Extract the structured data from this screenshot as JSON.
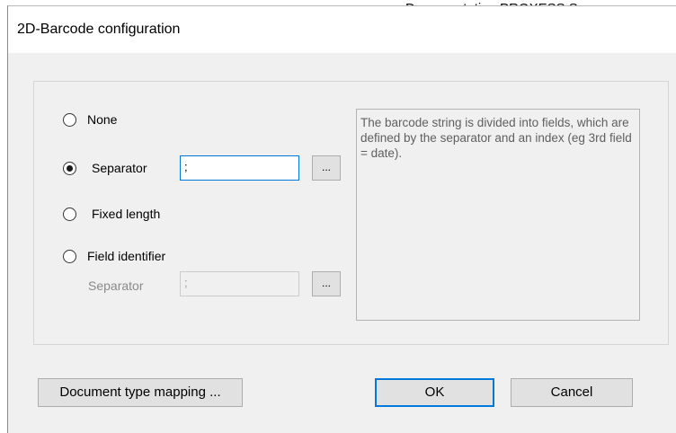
{
  "document_header": "Documentation PROXESS Scan",
  "dialog": {
    "title": "2D-Barcode configuration",
    "options": [
      {
        "label": "None",
        "selected": false
      },
      {
        "label": "Separator",
        "selected": true
      },
      {
        "label": "Fixed length",
        "selected": false
      },
      {
        "label": "Field identifier",
        "selected": false
      }
    ],
    "separator_value": ";",
    "browse_label": "...",
    "field_identifier_separator_label": "Separator",
    "field_identifier_separator_value": ";",
    "info_text": "The barcode string is divided into fields, which are defined by the separator and an index (eg 3rd field = date).",
    "buttons": {
      "document_type_mapping": "Document type mapping ...",
      "ok": "OK",
      "cancel": "Cancel"
    }
  }
}
